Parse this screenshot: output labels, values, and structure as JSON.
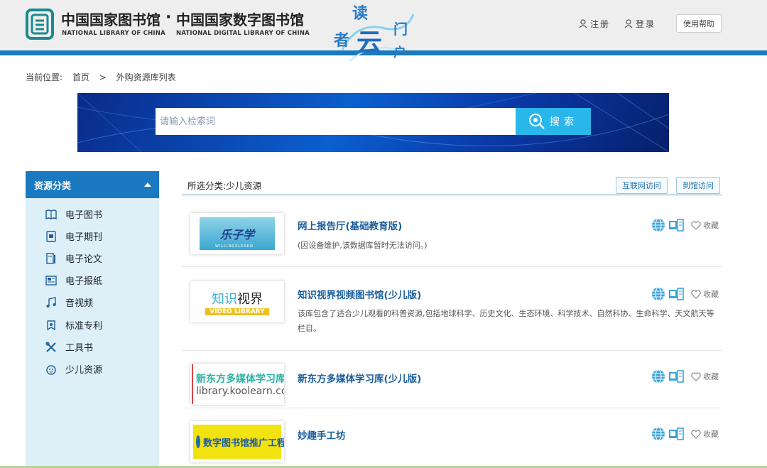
{
  "header": {
    "logo_cn_1": "中国国家图书馆",
    "logo_dot": "·",
    "logo_cn_2": "中国国家数字图书馆",
    "logo_en_1": "NATIONAL LIBRARY OF CHINA",
    "logo_en_2": "NATIONAL DIGITAL LIBRARY OF CHINA",
    "brand_art": "读者云门户",
    "register": "注册",
    "login": "登录",
    "help": "使用帮助",
    "accent": "#1a79c1"
  },
  "breadcrumb": {
    "prefix": "当前位置:",
    "home": "首页",
    "sep": ">",
    "current": "外购资源库列表"
  },
  "search": {
    "placeholder": "请输入检索词",
    "button": "搜索"
  },
  "sidebar": {
    "title": "资源分类",
    "items": [
      {
        "label": "电子图书",
        "icon": "book-icon"
      },
      {
        "label": "电子期刊",
        "icon": "journal-icon"
      },
      {
        "label": "电子论文",
        "icon": "paper-icon"
      },
      {
        "label": "电子报纸",
        "icon": "newspaper-icon"
      },
      {
        "label": "音视频",
        "icon": "music-icon"
      },
      {
        "label": "标准专利",
        "icon": "patent-icon"
      },
      {
        "label": "工具书",
        "icon": "tools-icon"
      },
      {
        "label": "少儿资源",
        "icon": "child-icon"
      }
    ]
  },
  "filter": {
    "label": "所选分类:少儿资源",
    "internet_btn": "互联网访问",
    "onsite_btn": "到馆访问"
  },
  "items": [
    {
      "title": "网上报告厅(基础教育版)",
      "desc": "(因设备维护,该数据库暂时无法访问。)",
      "fav": "收藏",
      "thumb_text": "乐子学",
      "thumb_sub": "WILLINGSLEARN"
    },
    {
      "title": "知识视界视频图书馆(少儿版)",
      "desc": "该库包含了适合少儿观看的科普资源,包括地球科学、历史文化、生态环境、科学技术、自然科协、生命科学、天文航天等栏目。",
      "fav": "收藏",
      "thumb_text_a": "知识",
      "thumb_text_b": "视界",
      "thumb_sub": "VIDEO LIBRARY"
    },
    {
      "title": "新东方多媒体学习库(少儿版)",
      "desc": "",
      "fav": "收藏",
      "thumb_text": "新东方多媒体学习库",
      "thumb_sub": "library.koolearn.com"
    },
    {
      "title": "妙趣手工坊",
      "desc": "",
      "fav": "收藏",
      "thumb_text": "数字图书馆推广工程"
    }
  ]
}
